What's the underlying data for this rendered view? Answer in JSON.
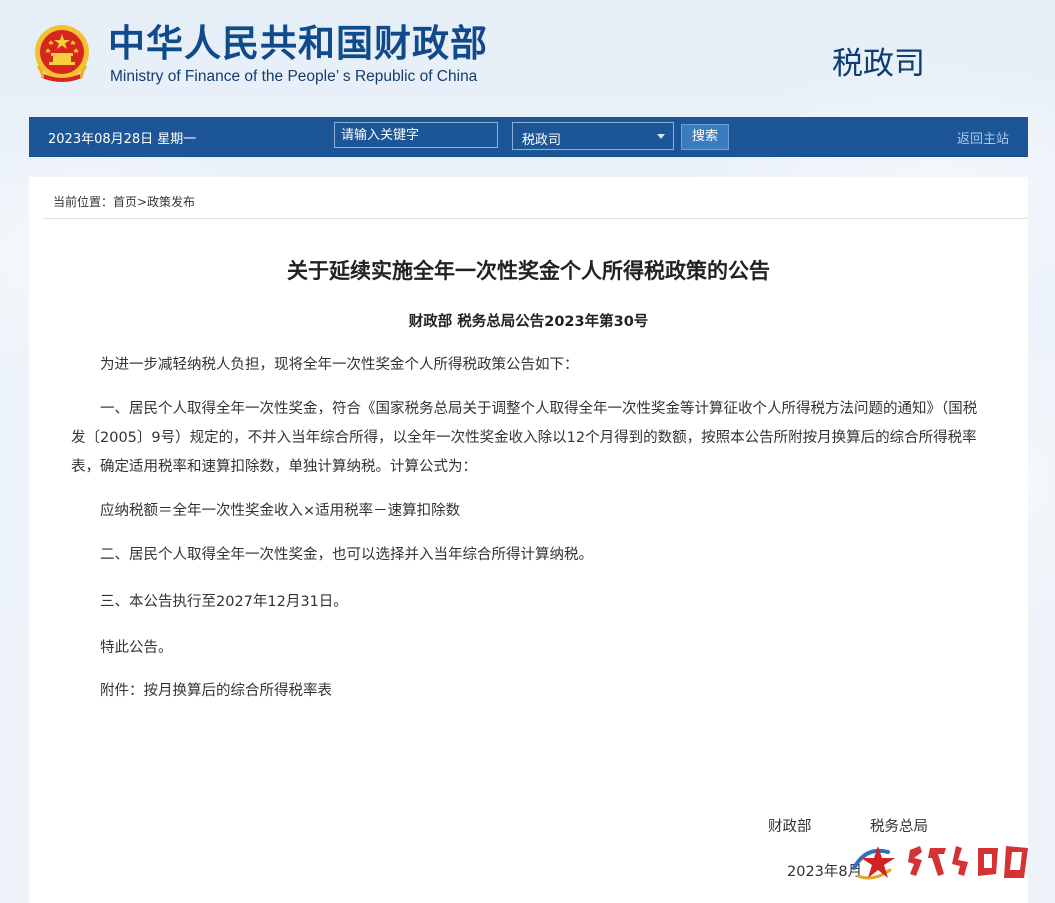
{
  "header": {
    "title_cn": "中华人民共和国财政部",
    "title_en": "Ministry of Finance of the People’ s Republic of China",
    "dept": "税政司",
    "emblem_icon": "national-emblem-icon"
  },
  "nav": {
    "date": "2023年08月28日  星期一",
    "search_placeholder": "请输入关键字",
    "select_value": "税政司",
    "search_button": "搜索",
    "home_link": "返回主站"
  },
  "breadcrumb": "当前位置：首页>政策发布",
  "document": {
    "title": "关于延续实施全年一次性奖金个人所得税政策的公告",
    "number": "财政部 税务总局公告2023年第30号",
    "paragraphs": [
      "为进一步减轻纳税人负担，现将全年一次性奖金个人所得税政策公告如下：",
      "一、居民个人取得全年一次性奖金，符合《国家税务总局关于调整个人取得全年一次性奖金等计算征收个人所得税方法问题的通知》（国税发〔2005〕9号）规定的，不并入当年综合所得，以全年一次性奖金收入除以12个月得到的数额，按照本公告所附按月换算后的综合所得税率表，确定适用税率和速算扣除数，单独计算纳税。计算公式为：",
      "应纳税额＝全年一次性奖金收入×适用税率－速算扣除数",
      "二、居民个人取得全年一次性奖金，也可以选择并入当年综合所得计算纳税。",
      "三、本公告执行至2027年12月31日。",
      "特此公告。",
      "附件：按月换算后的综合所得税率表"
    ],
    "signatures": [
      "财政部",
      "税务总局"
    ],
    "date": "2023年8月"
  },
  "colors": {
    "navbar": "#1c5696",
    "title_blue": "#0f4a8a",
    "accent_red": "#d22222"
  }
}
